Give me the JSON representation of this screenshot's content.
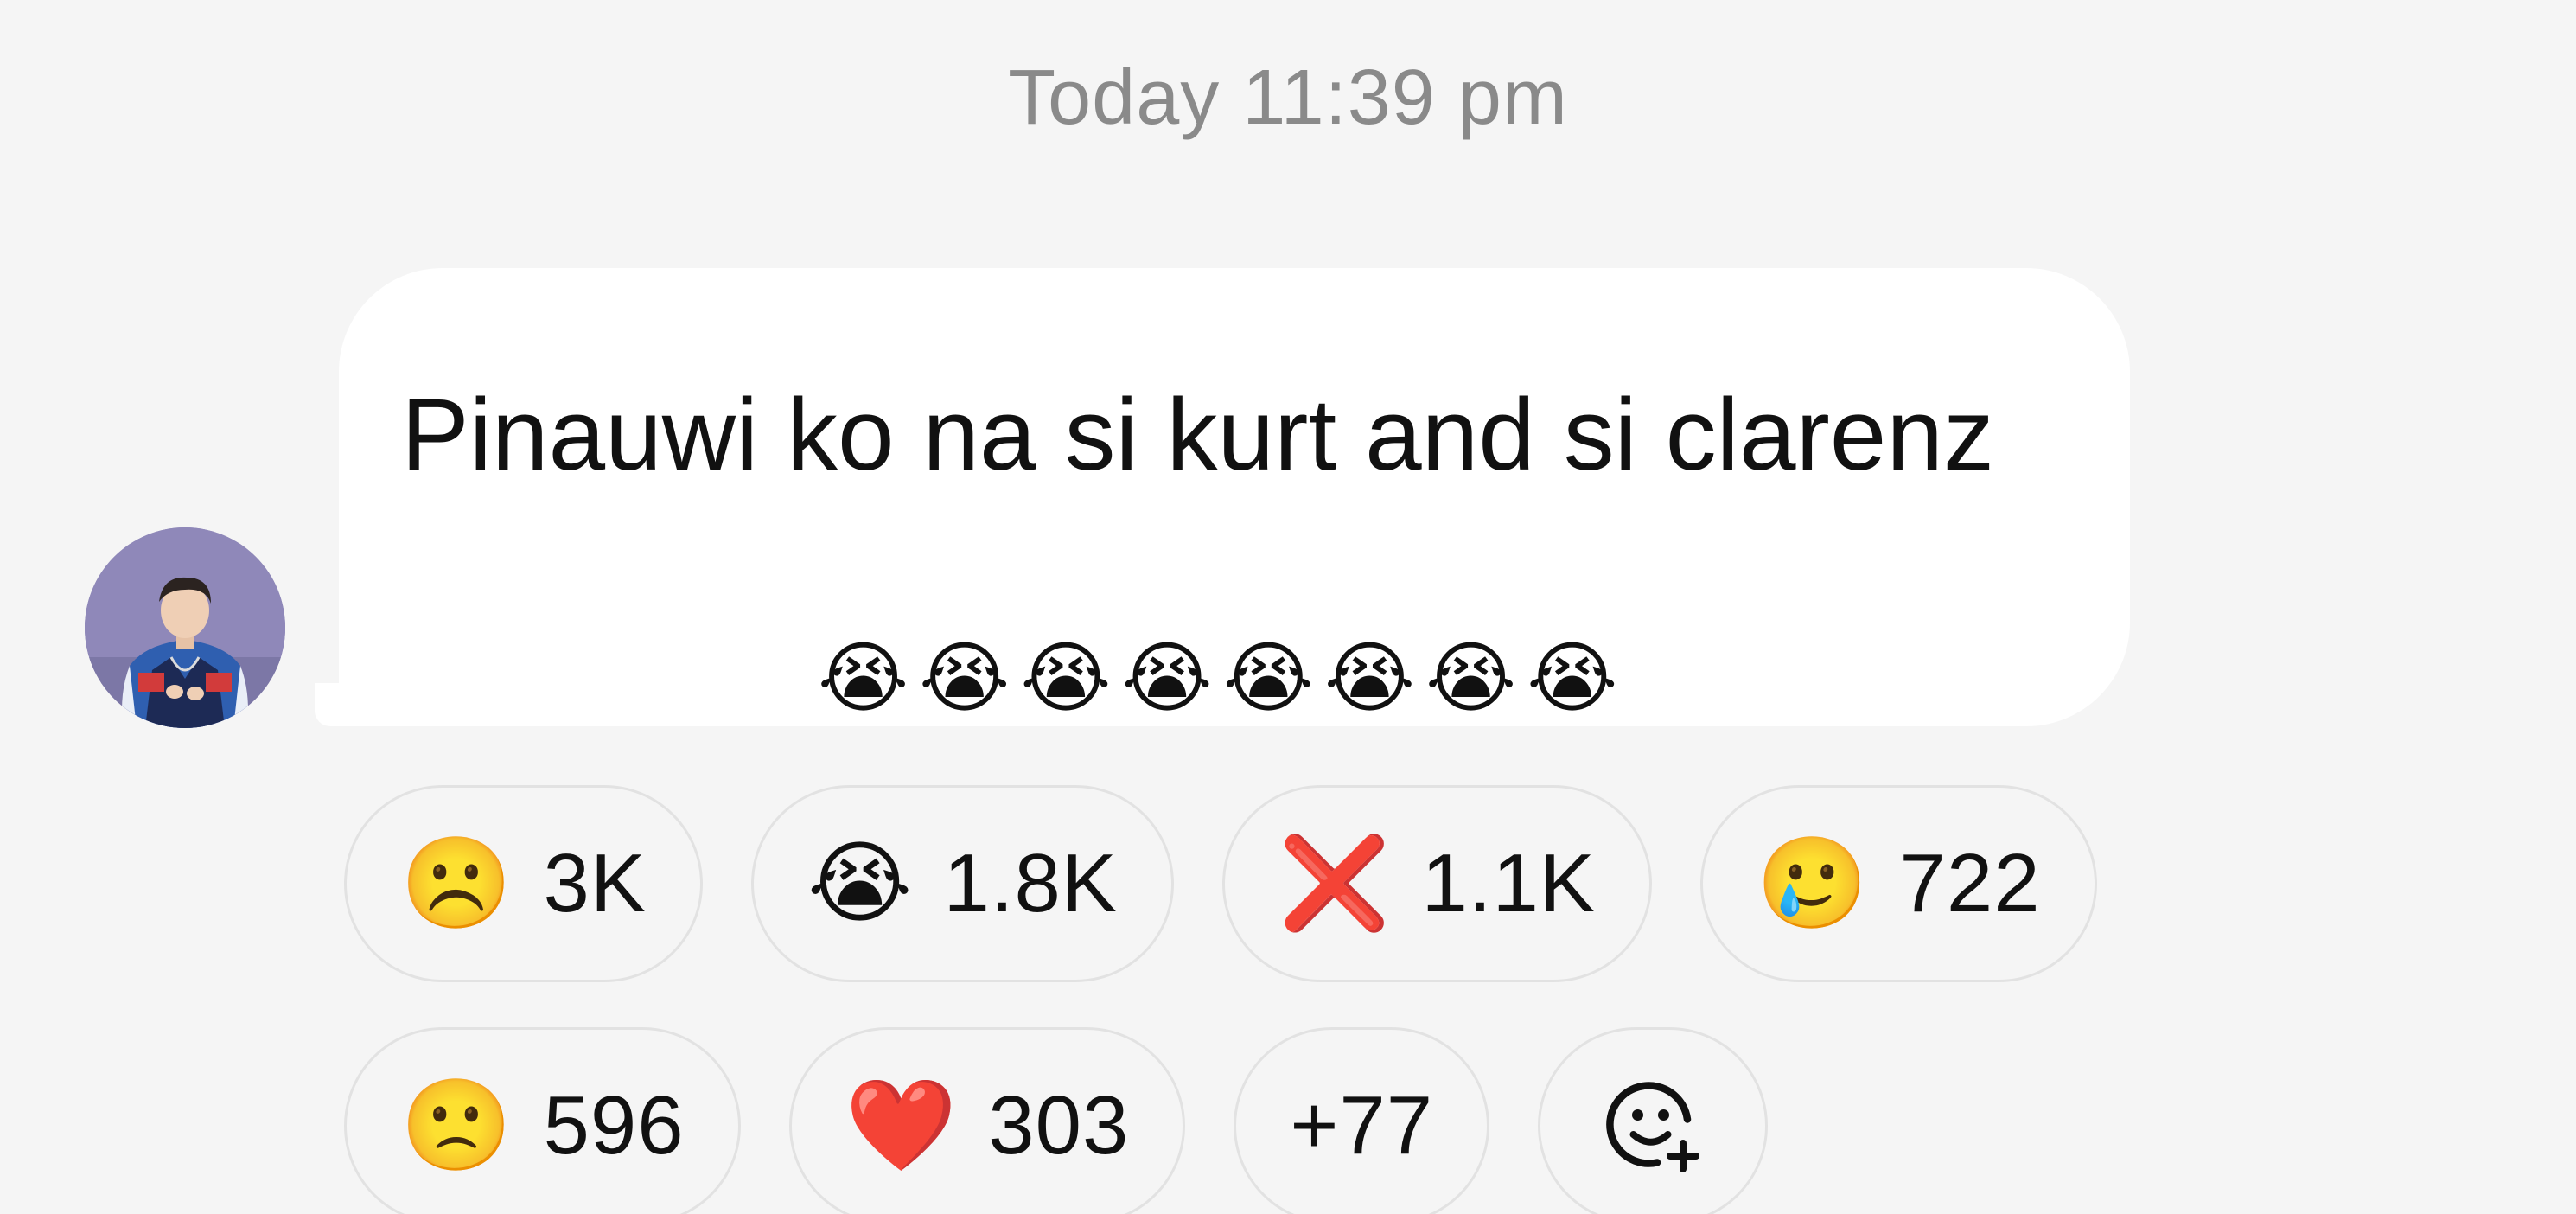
{
  "timestamp": "Today 11:39 pm",
  "message": {
    "text": "Pinauwi ko na si kurt and si clarenz",
    "trailing_emojis": [
      "😭",
      "😭",
      "😭",
      "😭",
      "😭",
      "😭",
      "😭",
      "😭"
    ]
  },
  "reactions": {
    "row1": [
      {
        "emoji": "☹️",
        "count": "3K"
      },
      {
        "emoji": "😭",
        "count": "1.8K"
      },
      {
        "emoji": "❌",
        "count": "1.1K"
      },
      {
        "emoji": "🥲",
        "count": "722"
      }
    ],
    "row2": [
      {
        "emoji": "🙁",
        "count": "596"
      },
      {
        "emoji": "❤️",
        "count": "303"
      }
    ],
    "more": "+77",
    "add_icon": "add-reaction-icon"
  },
  "colors": {
    "background": "#f5f5f5",
    "bubble": "#ffffff",
    "timestamp": "#8a8a8a",
    "pill_border": "#e2e2e2"
  }
}
